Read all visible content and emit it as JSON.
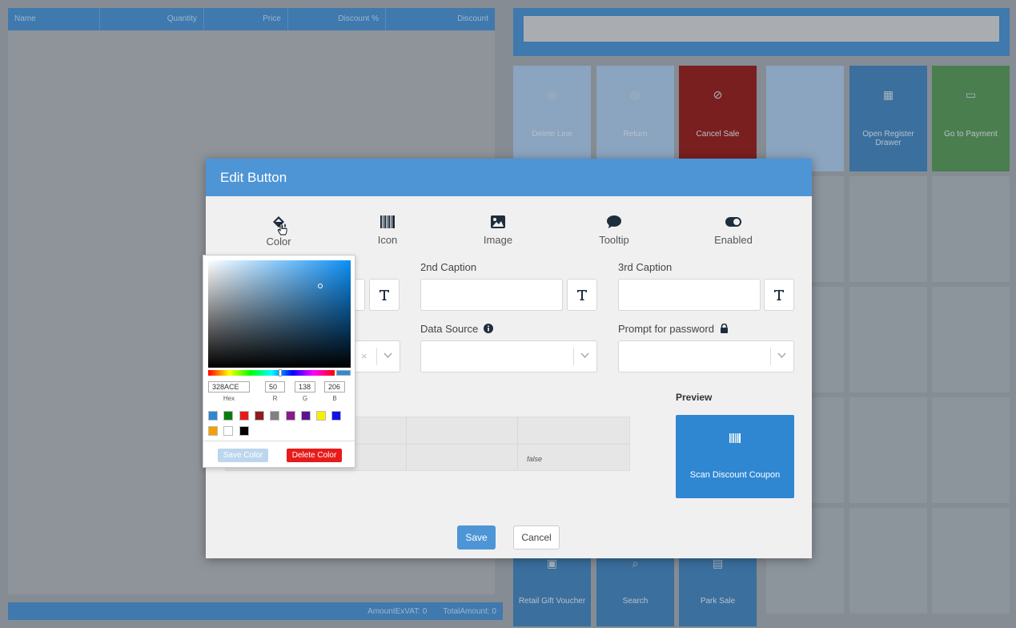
{
  "background": {
    "table_headers": [
      "Name",
      "Quantity",
      "Price",
      "Discount %",
      "Discount"
    ],
    "footer": [
      "AmountExVAT: 0",
      "TotalAmount: 0"
    ],
    "tiles": [
      "Delete Line",
      "Return",
      "Cancel Sale",
      "Open Register Drawer",
      "Go to Payment",
      "Retail Gift Voucher",
      "Search",
      "Park Sale"
    ]
  },
  "modal": {
    "title": "Edit Button",
    "tabs": [
      {
        "label": "Color",
        "icon": "paint-bucket-icon"
      },
      {
        "label": "Icon",
        "icon": "barcode-icon"
      },
      {
        "label": "Image",
        "icon": "image-icon"
      },
      {
        "label": "Tooltip",
        "icon": "comment-icon"
      },
      {
        "label": "Enabled",
        "icon": "toggle-on-icon"
      }
    ],
    "fields": {
      "caption2_label": "2nd Caption",
      "caption3_label": "3rd Caption",
      "data_source_label": "Data Source",
      "prompt_password_label": "Prompt for password"
    },
    "grid_value": "false",
    "preview_label": "Preview",
    "preview_caption": "Scan Discount Coupon",
    "save_label": "Save",
    "cancel_label": "Cancel"
  },
  "picker": {
    "hex": "328ACE",
    "r": "50",
    "g": "138",
    "b": "206",
    "labels": {
      "hex": "Hex",
      "r": "R",
      "g": "G",
      "b": "B"
    },
    "current_color": "#328ace",
    "swatches": [
      "#2f87d2",
      "#0c7a0c",
      "#e81b1b",
      "#8b1e1e",
      "#808080",
      "#8b1a8b",
      "#5a1490",
      "#f5f000",
      "#1010e8",
      "#f5a000",
      "#ffffff",
      "#000000"
    ],
    "save_color_label": "Save Color",
    "delete_color_label": "Delete Color"
  },
  "colors": {
    "accent": "#4e95d6",
    "preview": "#2f87d2",
    "danger": "#e81b1b"
  }
}
